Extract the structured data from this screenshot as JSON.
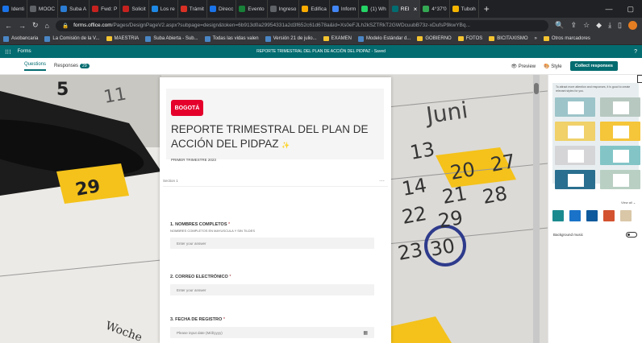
{
  "browser": {
    "tabs": [
      {
        "label": "Identi",
        "color": "#1a73e8"
      },
      {
        "label": "MOOC",
        "color": "#5f6368"
      },
      {
        "label": "Suba A",
        "color": "#2b7cd3"
      },
      {
        "label": "Fwd: P",
        "color": "#c5221f"
      },
      {
        "label": "Solicit",
        "color": "#c5221f"
      },
      {
        "label": "Los re",
        "color": "#1e88e5"
      },
      {
        "label": "Trámit",
        "color": "#d93025"
      },
      {
        "label": "Direcc",
        "color": "#1a73e8"
      },
      {
        "label": "Evento",
        "color": "#188038"
      },
      {
        "label": "Ingreso",
        "color": "#5f6368"
      },
      {
        "label": "Edifica",
        "color": "#f9ab00"
      },
      {
        "label": "Inform",
        "color": "#4285f4"
      },
      {
        "label": "(1) Wh",
        "color": "#25d366"
      },
      {
        "label": "REI",
        "color": "#036c70",
        "active": true
      },
      {
        "label": "4°37'0",
        "color": "#34a853"
      },
      {
        "label": "Tuboh",
        "color": "#f4b400"
      }
    ],
    "url_host": "forms.office.com",
    "url_rest": "/Pages/DesignPageV2.aspx?subpage=design&token=6b913d0a29954331a2d3f652c61d678a&id=Xs0eFJLh2kSZTRkT2GWDcuubB73z-xDufsP9kwYBq...",
    "bookmarks": [
      {
        "label": "Asobancaria",
        "type": "site"
      },
      {
        "label": "La Comisión de la V...",
        "type": "site"
      },
      {
        "label": "MAESTRIA",
        "type": "folder"
      },
      {
        "label": "Suba Abierta - Sub...",
        "type": "site"
      },
      {
        "label": "Todas las vidas valen",
        "type": "site"
      },
      {
        "label": "Versión 21 de julio...",
        "type": "site"
      },
      {
        "label": "EXAMEN",
        "type": "folder"
      },
      {
        "label": "Modelo Estándar d...",
        "type": "site"
      },
      {
        "label": "GOBIERNO",
        "type": "folder"
      },
      {
        "label": "FOTOS",
        "type": "folder"
      },
      {
        "label": "BICITAXISMO",
        "type": "folder"
      },
      {
        "label": "»",
        "type": "more"
      },
      {
        "label": "Otros marcadores",
        "type": "folder"
      }
    ]
  },
  "forms": {
    "app_name": "Forms",
    "doc_title": "REPORTE TRIMESTRAL DEL PLAN DE ACCIÓN DEL PIDPAZ",
    "doc_status": "Saved",
    "help": "?",
    "tab_questions": "Questions",
    "tab_responses": "Responses",
    "responses_count": "29",
    "preview": "Preview",
    "style": "Style",
    "collect": "Collect responses"
  },
  "form": {
    "logo": "BOGOTÁ",
    "title": "REPORTE TRIMESTRAL DEL PLAN DE ACCIÓN DEL PIDPAZ",
    "subtitle": "PRIMER TRIMESTRE 2023",
    "section": "Section 1",
    "questions": [
      {
        "num": "1.",
        "title": "NOMBRES COMPLETOS",
        "hint": "NOMBRES COMPLETOS EN MAYUSCULA Y SIN TILDES",
        "placeholder": "Enter your answer"
      },
      {
        "num": "2.",
        "title": "CORREO ELECTRÓNICO",
        "hint": "",
        "placeholder": "Enter your answer"
      },
      {
        "num": "3.",
        "title": "FECHA DE REGISTRO",
        "hint": "",
        "placeholder": "Please input date (M/d/yyyy)"
      }
    ]
  },
  "background_texts": {
    "month": "Juni",
    "numbers": [
      "11",
      "29",
      "13",
      "20",
      "27",
      "14",
      "21",
      "28",
      "22",
      "29",
      "30",
      "23",
      "5"
    ],
    "woche": "Woche"
  },
  "panel": {
    "hint": "To attract more attention and responses, it is good to create relevant styles for you.",
    "view_all": "View all",
    "swatches": [
      "#1b8a8f",
      "#1a73c8",
      "#0f5a9c",
      "#d35230",
      "#d9c7a8"
    ],
    "bg_music": "Background music"
  }
}
